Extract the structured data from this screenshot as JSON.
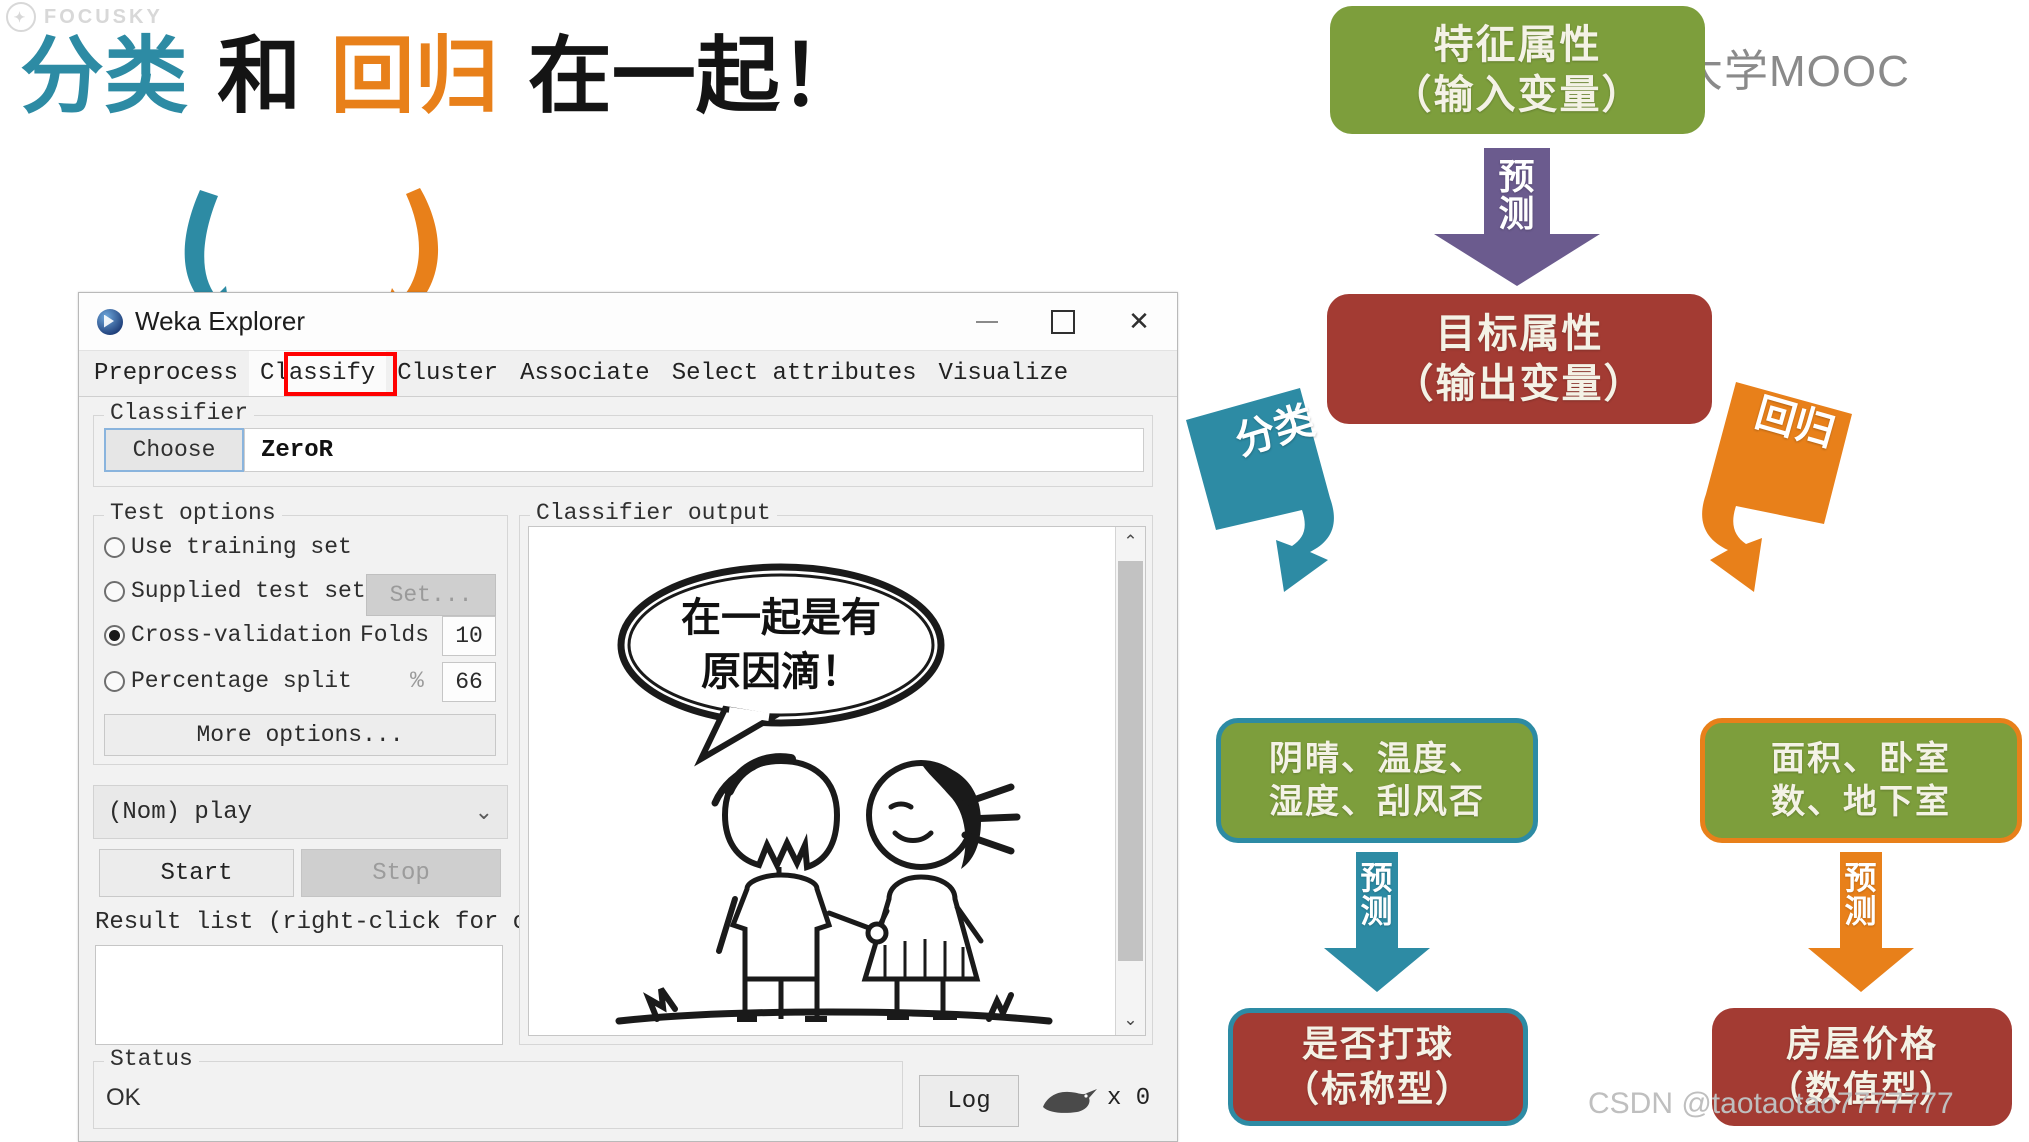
{
  "watermarks": {
    "focusky": "FOCUSKY",
    "mooc": "中国大学MOOC",
    "csdn": "CSDN @taotaotao7777777"
  },
  "headline": {
    "part1": "分类",
    "part2": "和",
    "part3": "回归",
    "part4": "在一起！"
  },
  "weka": {
    "title": "Weka Explorer",
    "window_controls": {
      "minimize": "—",
      "maximize": "□",
      "close": "✕"
    },
    "tabs": [
      {
        "label": "Preprocess",
        "active": false
      },
      {
        "label": "Classify",
        "active": true
      },
      {
        "label": "Cluster",
        "active": false
      },
      {
        "label": "Associate",
        "active": false
      },
      {
        "label": "Select attributes",
        "active": false
      },
      {
        "label": "Visualize",
        "active": false
      }
    ],
    "classifier": {
      "group_title": "Classifier",
      "choose_label": "Choose",
      "value": "ZeroR"
    },
    "test_options": {
      "group_title": "Test options",
      "items": [
        {
          "label": "Use training set",
          "selected": false
        },
        {
          "label": "Supplied test set",
          "selected": false
        },
        {
          "label": "Cross-validation",
          "selected": true
        },
        {
          "label": "Percentage split",
          "selected": false
        }
      ],
      "set_button": "Set...",
      "folds_label": "Folds",
      "folds_value": "10",
      "percent_label": "%",
      "percent_value": "66",
      "more_options": "More options..."
    },
    "class_select": {
      "value": "(Nom) play",
      "chevron": "⌄"
    },
    "start_label": "Start",
    "stop_label": "Stop",
    "result_list_label": "Result list (right-click for optio",
    "output": {
      "group_title": "Classifier output",
      "speech_line1": "在一起是有",
      "speech_line2": "原因滴！",
      "scroll_up": "⌃",
      "scroll_down": "⌄"
    },
    "status": {
      "group_title": "Status",
      "value": "OK"
    },
    "log_label": "Log",
    "bird_count": "x 0"
  },
  "flow": {
    "colors": {
      "green": "#7d9e3c",
      "purple": "#6b5b8e",
      "red": "#a33b33",
      "teal": "#2d8ba4",
      "orange": "#e8801a"
    },
    "top_box": {
      "line1": "特征属性",
      "line2": "（输入变量）"
    },
    "predict_arrow_top": {
      "line1": "预",
      "line2": "测"
    },
    "target_box": {
      "line1": "目标属性",
      "line2": "（输出变量）"
    },
    "branch_left_label": "分类",
    "branch_right_label": "回归",
    "left_feature_box": {
      "line1": "阴晴、温度、",
      "line2": "湿度、刮风否"
    },
    "right_feature_box": {
      "line1": "面积、卧室",
      "line2": "数、地下室"
    },
    "left_predict_arrow": {
      "line1": "预",
      "line2": "测"
    },
    "right_predict_arrow": {
      "line1": "预",
      "line2": "测"
    },
    "left_result_box": {
      "line1": "是否打球",
      "line2": "（标称型）"
    },
    "right_result_box": {
      "line1": "房屋价格",
      "line2": "（数值型）"
    }
  }
}
